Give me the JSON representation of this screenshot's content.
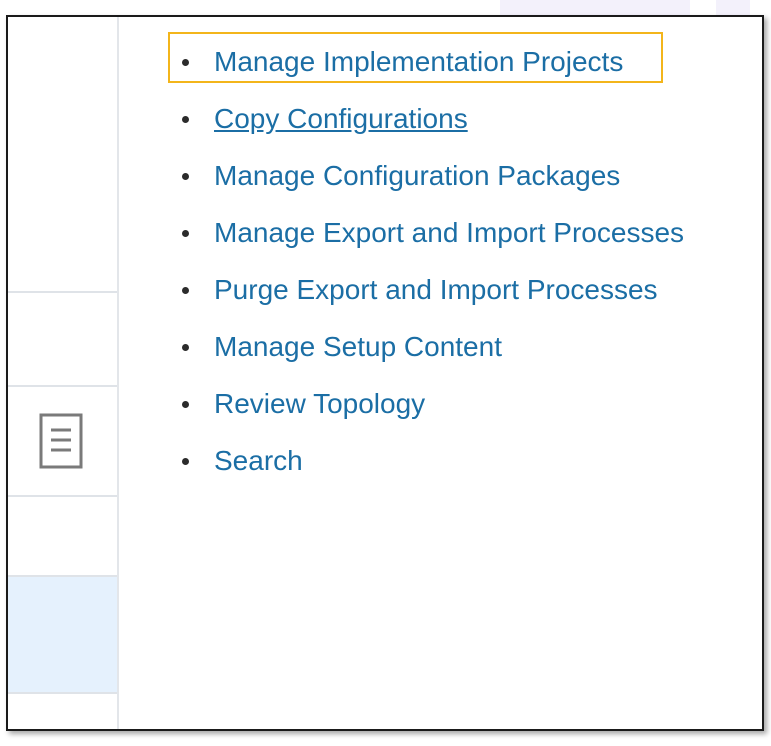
{
  "menu": {
    "items": [
      {
        "label": "Manage Implementation Projects",
        "focused": true
      },
      {
        "label": "Copy Configurations",
        "underlined": true
      },
      {
        "label": "Manage Configuration Packages"
      },
      {
        "label": "Manage Export and Import Processes"
      },
      {
        "label": "Purge Export and Import Processes"
      },
      {
        "label": "Manage Setup Content"
      },
      {
        "label": "Review Topology"
      },
      {
        "label": "Search"
      }
    ]
  },
  "left_panel": {
    "icon": "document-list-icon"
  },
  "colors": {
    "link": "#1b6ea5",
    "focus_outline": "#f3b51b",
    "selected_row": "#e5f1fd",
    "frame_border": "#1a1a1a"
  }
}
